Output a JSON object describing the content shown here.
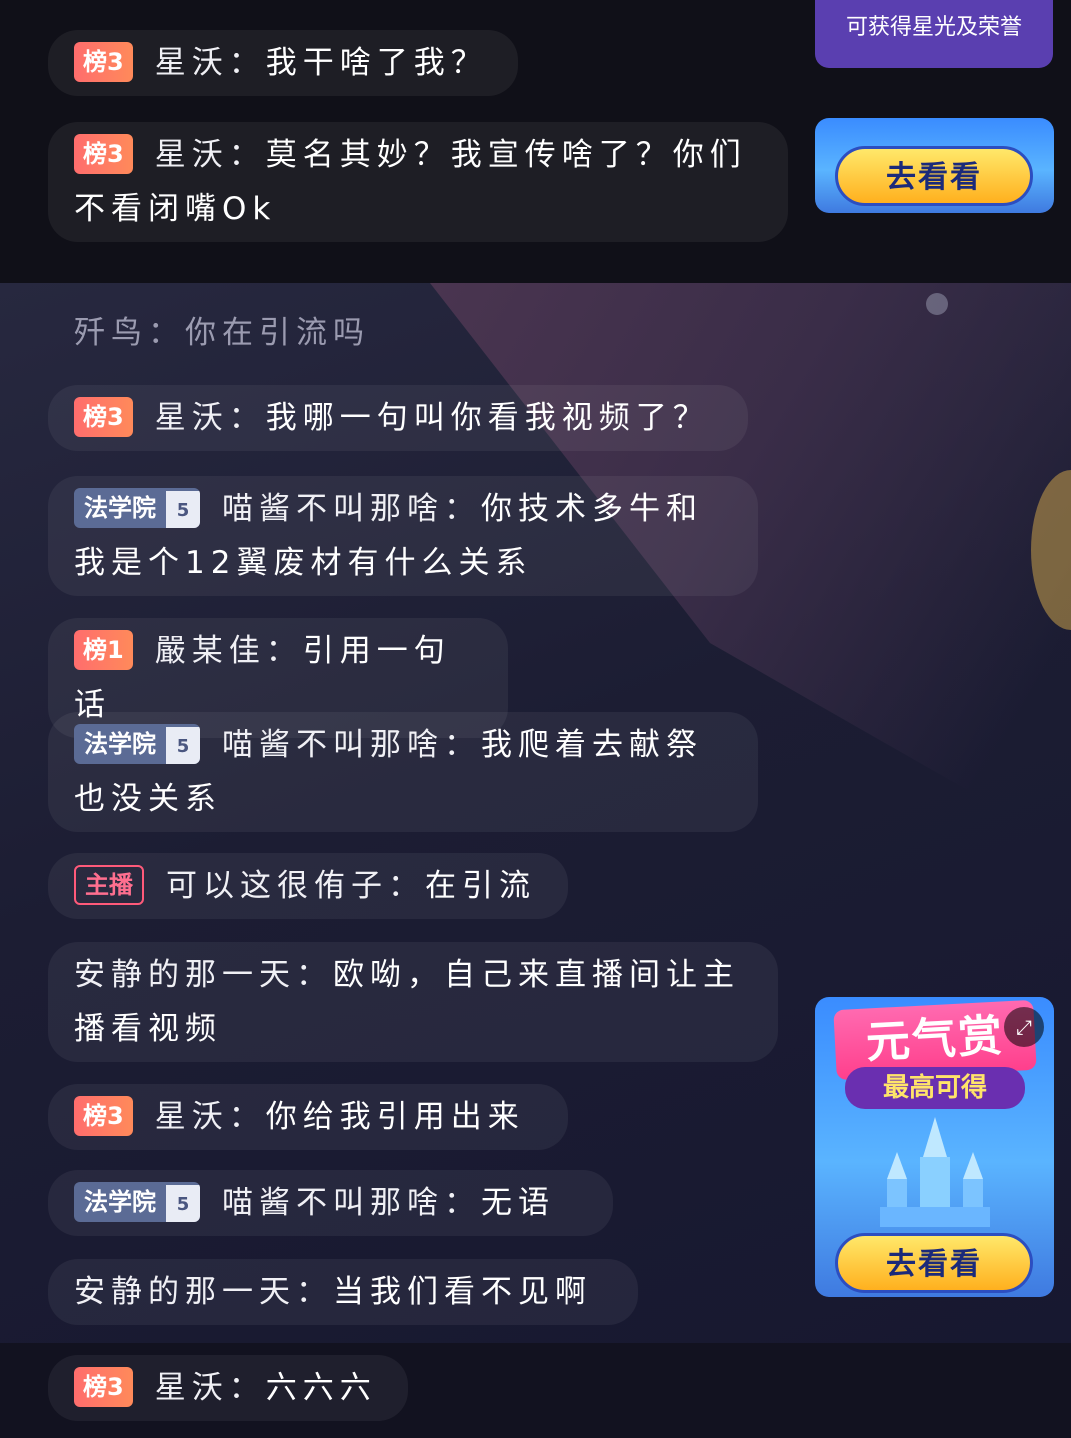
{
  "top_notice": "可获得星光及荣誉",
  "promo_top": {
    "button": "去看看"
  },
  "promo_bottom": {
    "title": "元气赏",
    "subtitle": "最高可得",
    "button": "去看看",
    "expand_icon": "expand-icon"
  },
  "messages": [
    {
      "badge": "榜3",
      "name": "星沃",
      "sep": "：",
      "text": "我干啥了我？"
    },
    {
      "badge": "榜3",
      "name": "星沃",
      "sep": "：",
      "text": "莫名其妙？我宣传啥了？你们不看闭嘴Ok"
    },
    {
      "name": "歼鸟",
      "sep": "：",
      "text": "你在引流吗"
    },
    {
      "badge": "榜3",
      "name": "星沃",
      "sep": "：",
      "text": "我哪一句叫你看我视频了？"
    },
    {
      "badge": "法学院",
      "level": "5",
      "name": "喵酱不叫那啥",
      "sep": "：",
      "text": "你技术多牛和我是个12翼废材有什么关系"
    },
    {
      "badge": "榜1",
      "name": "嚴某佳",
      "sep": "：",
      "text": "引用一句话"
    },
    {
      "badge": "法学院",
      "level": "5",
      "name": "喵酱不叫那啥",
      "sep": "：",
      "text": "我爬着去献祭也没关系"
    },
    {
      "badge": "主播",
      "name": "可以这很侑子",
      "sep": "：",
      "text": "在引流"
    },
    {
      "name": "安静的那一天",
      "sep": "：",
      "text": "欧呦，自己来直播间让主播看视频"
    },
    {
      "badge": "榜3",
      "name": "星沃",
      "sep": "：",
      "text": "你给我引用出来"
    },
    {
      "badge": "法学院",
      "level": "5",
      "name": "喵酱不叫那啥",
      "sep": "：",
      "text": "无语"
    },
    {
      "name": "安静的那一天",
      "sep": "：",
      "text": "当我们看不见啊"
    },
    {
      "badge": "榜3",
      "name": "星沃",
      "sep": "：",
      "text": "六六六"
    }
  ]
}
